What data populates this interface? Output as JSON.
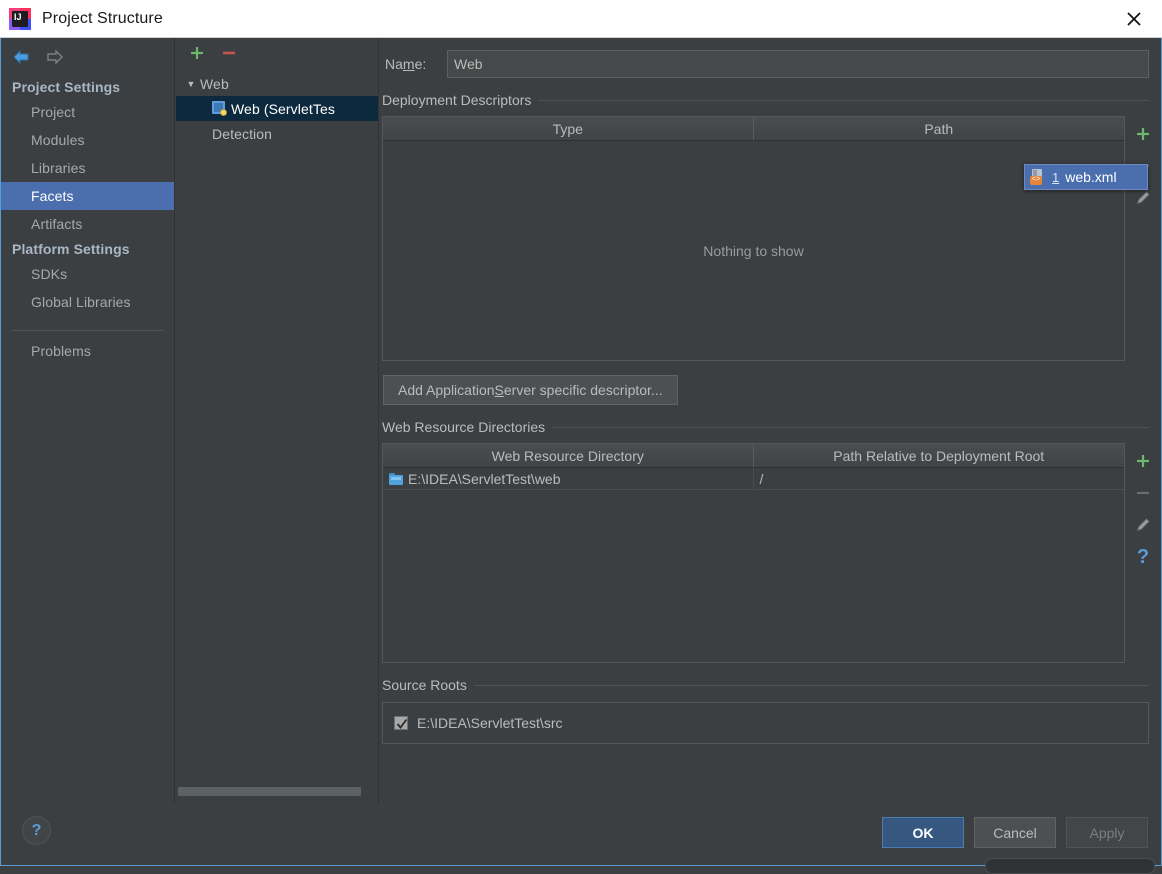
{
  "window": {
    "title": "Project Structure",
    "logo_icon": "intellij-idea-logo",
    "close_icon": "close-icon"
  },
  "sidebar": {
    "back_icon": "arrow-left-icon",
    "forward_icon": "arrow-right-icon",
    "groups": [
      {
        "heading": "Project Settings",
        "items": [
          {
            "label": "Project",
            "selected": false
          },
          {
            "label": "Modules",
            "selected": false
          },
          {
            "label": "Libraries",
            "selected": false
          },
          {
            "label": "Facets",
            "selected": true
          },
          {
            "label": "Artifacts",
            "selected": false
          }
        ]
      },
      {
        "heading": "Platform Settings",
        "items": [
          {
            "label": "SDKs",
            "selected": false
          },
          {
            "label": "Global Libraries",
            "selected": false
          }
        ]
      }
    ],
    "problems_label": "Problems"
  },
  "tree": {
    "add_icon": "plus-icon",
    "remove_icon": "minus-icon",
    "nodes": [
      {
        "label": "Web",
        "type": "group",
        "expanded": true,
        "twisty": "▼"
      },
      {
        "label": "Web (ServletTes",
        "type": "facet",
        "selected": true,
        "icon": "web-facet-icon"
      },
      {
        "label": "Detection",
        "type": "group"
      }
    ]
  },
  "content": {
    "name_label_pre": "Na",
    "name_label_mnemonic": "m",
    "name_label_post": "e:",
    "name_value": "Web",
    "deployment_descriptors": {
      "title": "Deployment Descriptors",
      "columns": [
        "Type",
        "Path"
      ],
      "rows": [],
      "empty_message": "Nothing to show",
      "tools": [
        {
          "name": "add-descriptor-button",
          "icon": "plus-icon"
        },
        {
          "name": "remove-descriptor-button",
          "icon": "minus-icon"
        },
        {
          "name": "edit-descriptor-button",
          "icon": "pencil-icon"
        }
      ]
    },
    "add_descriptor_button": {
      "pre": "Add Application ",
      "mnemonic": "S",
      "post": "erver specific descriptor..."
    },
    "web_resource_directories": {
      "title": "Web Resource Directories",
      "columns": [
        "Web Resource Directory",
        "Path Relative to Deployment Root"
      ],
      "rows": [
        {
          "directory": "E:\\IDEA\\ServletTest\\web",
          "relative_path": "/",
          "icon": "folder-icon"
        }
      ],
      "tools": [
        {
          "name": "add-web-resource-button",
          "icon": "plus-icon"
        },
        {
          "name": "remove-web-resource-button",
          "icon": "minus-icon"
        },
        {
          "name": "edit-web-resource-button",
          "icon": "pencil-icon"
        },
        {
          "name": "help-web-resource-button",
          "icon": "question-icon"
        }
      ]
    },
    "source_roots": {
      "title": "Source Roots",
      "rows": [
        {
          "label": "E:\\IDEA\\ServletTest\\src",
          "checked": true
        }
      ]
    }
  },
  "popup": {
    "icon": "xml-file-icon",
    "number": "1",
    "label": "web.xml"
  },
  "footer": {
    "help_icon": "question-icon",
    "ok_label": "OK",
    "cancel_label": "Cancel",
    "apply_label": "Apply"
  },
  "colors": {
    "background": "#3c3f41",
    "accent_selected": "#4b6eaf",
    "tree_selected": "#0d293e",
    "primary_button": "#365880",
    "text": "#bbbbbb",
    "dialog_border": "#5b9bd5"
  }
}
